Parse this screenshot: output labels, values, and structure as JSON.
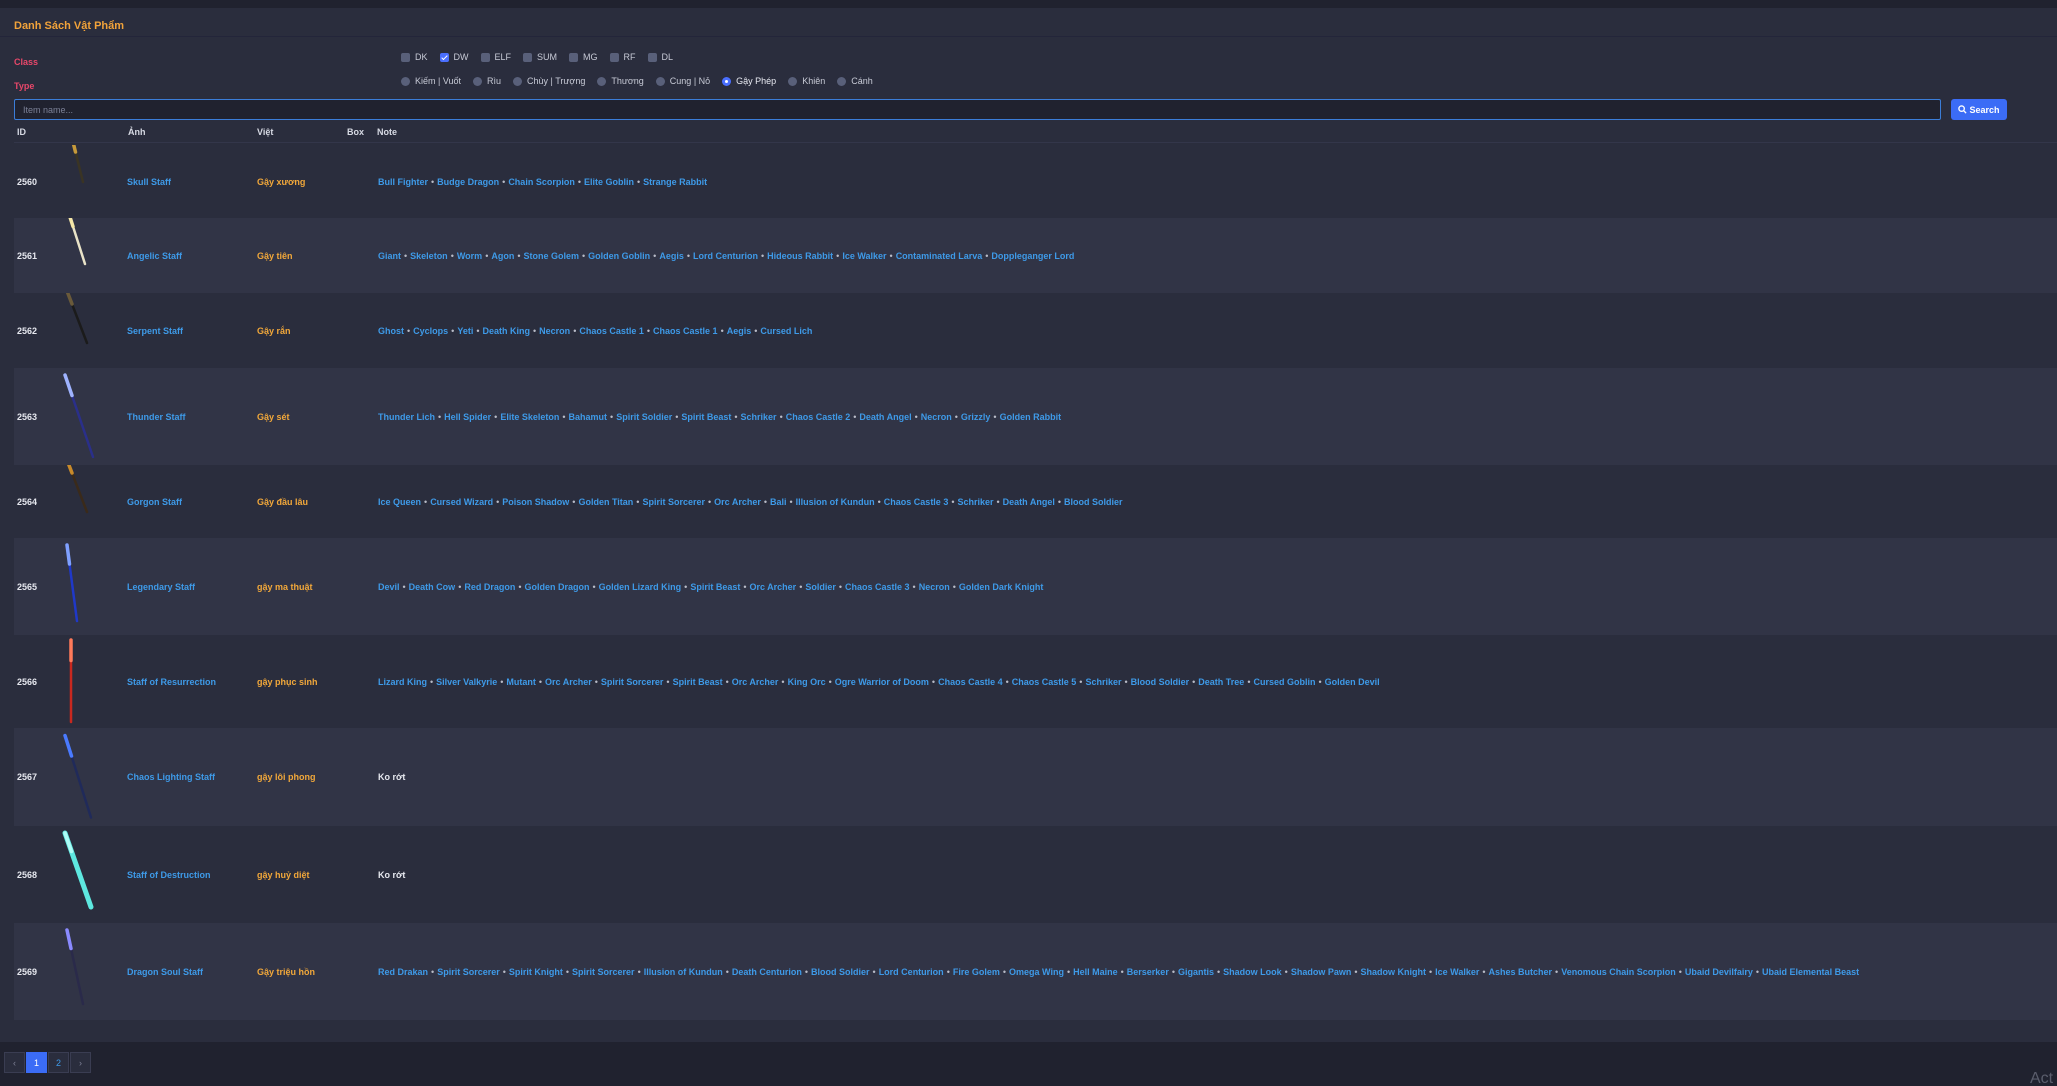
{
  "title": "Danh Sách Vật Phẩm",
  "filters": {
    "class_label": "Class",
    "type_label": "Type",
    "classes": [
      {
        "label": "DK",
        "checked": false
      },
      {
        "label": "DW",
        "checked": true
      },
      {
        "label": "ELF",
        "checked": false
      },
      {
        "label": "SUM",
        "checked": false
      },
      {
        "label": "MG",
        "checked": false
      },
      {
        "label": "RF",
        "checked": false
      },
      {
        "label": "DL",
        "checked": false
      }
    ],
    "types": [
      {
        "label": "Kiếm | Vuốt",
        "selected": false
      },
      {
        "label": "Rìu",
        "selected": false
      },
      {
        "label": "Chùy | Trượng",
        "selected": false
      },
      {
        "label": "Thương",
        "selected": false
      },
      {
        "label": "Cung | Nỏ",
        "selected": false
      },
      {
        "label": "Gậy Phép",
        "selected": true
      },
      {
        "label": "Khiên",
        "selected": false
      },
      {
        "label": "Cánh",
        "selected": false
      }
    ]
  },
  "search": {
    "placeholder": "Item name...",
    "value": "",
    "button_label": "Search"
  },
  "table": {
    "headers": {
      "id": "ID",
      "img": "Ảnh",
      "viet": "Việt",
      "box": "Box",
      "note": "Note"
    },
    "rows": [
      {
        "id": "2560",
        "name": "Skull Staff",
        "viet": "Gậy xương",
        "icon": "skull-staff-icon",
        "note": [
          "Bull Fighter",
          "Budge Dragon",
          "Chain Scorpion",
          "Elite Goblin",
          "Strange Rabbit"
        ]
      },
      {
        "id": "2561",
        "name": "Angelic Staff",
        "viet": "Gậy tiên",
        "icon": "angelic-staff-icon",
        "note": [
          "Giant",
          "Skeleton",
          "Worm",
          "Agon",
          "Stone Golem",
          "Golden Goblin",
          "Aegis",
          "Lord Centurion",
          "Hideous Rabbit",
          "Ice Walker",
          "Contaminated Larva",
          "Doppleganger Lord"
        ]
      },
      {
        "id": "2562",
        "name": "Serpent Staff",
        "viet": "Gậy rắn",
        "icon": "serpent-staff-icon",
        "note": [
          "Ghost",
          "Cyclops",
          "Yeti",
          "Death King",
          "Necron",
          "Chaos Castle 1",
          "Chaos Castle 1",
          "Aegis",
          "Cursed Lich"
        ]
      },
      {
        "id": "2563",
        "name": "Thunder Staff",
        "viet": "Gậy sét",
        "icon": "thunder-staff-icon",
        "note": [
          "Thunder Lich",
          "Hell Spider",
          "Elite Skeleton",
          "Bahamut",
          "Spirit Soldier",
          "Spirit Beast",
          "Schriker",
          "Chaos Castle 2",
          "Death Angel",
          "Necron",
          "Grizzly",
          "Golden Rabbit"
        ]
      },
      {
        "id": "2564",
        "name": "Gorgon Staff",
        "viet": "Gậy đầu lâu",
        "icon": "gorgon-staff-icon",
        "note": [
          "Ice Queen",
          "Cursed Wizard",
          "Poison Shadow",
          "Golden Titan",
          "Spirit Sorcerer",
          "Orc Archer",
          "Bali",
          "Illusion of Kundun",
          "Chaos Castle 3",
          "Schriker",
          "Death Angel",
          "Blood Soldier"
        ]
      },
      {
        "id": "2565",
        "name": "Legendary Staff",
        "viet": "gậy ma thuật",
        "icon": "legendary-staff-icon",
        "note": [
          "Devil",
          "Death Cow",
          "Red Dragon",
          "Golden Dragon",
          "Golden Lizard King",
          "Spirit Beast",
          "Orc Archer",
          "Soldier",
          "Chaos Castle 3",
          "Necron",
          "Golden Dark Knight"
        ]
      },
      {
        "id": "2566",
        "name": "Staff of Resurrection",
        "viet": "gậy phục sinh",
        "icon": "resurrection-staff-icon",
        "note": [
          "Lizard King",
          "Silver Valkyrie",
          "Mutant",
          "Orc Archer",
          "Spirit Sorcerer",
          "Spirit Beast",
          "Orc Archer",
          "King Orc",
          "Ogre Warrior of Doom",
          "Chaos Castle 4",
          "Chaos Castle 5",
          "Schriker",
          "Blood Soldier",
          "Death Tree",
          "Cursed Goblin",
          "Golden Devil"
        ]
      },
      {
        "id": "2567",
        "name": "Chaos Lighting Staff",
        "viet": "gậy lôi phong",
        "icon": "chaos-lighting-staff-icon",
        "note_plain": "Ko rớt"
      },
      {
        "id": "2568",
        "name": "Staff of Destruction",
        "viet": "gậy huỷ diệt",
        "icon": "destruction-staff-icon",
        "note_plain": "Ko rớt"
      },
      {
        "id": "2569",
        "name": "Dragon Soul Staff",
        "viet": "Gậy triệu hồn",
        "icon": "dragon-soul-staff-icon",
        "note": [
          "Red Drakan",
          "Spirit Sorcerer",
          "Spirit Knight",
          "Spirit Sorcerer",
          "Illusion of Kundun",
          "Death Centurion",
          "Blood Soldier",
          "Lord Centurion",
          "Fire Golem",
          "Omega Wing",
          "Hell Maine",
          "Berserker",
          "Gigantis",
          "Shadow Look",
          "Shadow Pawn",
          "Shadow Knight",
          "Ice Walker",
          "Ashes Butcher",
          "Venomous Chain Scorpion",
          "Ubaid Devilfairy",
          "Ubaid Elemental Beast"
        ]
      }
    ]
  },
  "pagination": {
    "prev": "‹",
    "next": "›",
    "pages": [
      "1",
      "2"
    ],
    "current": "1"
  },
  "watermark": "Act",
  "colors": {
    "accent": "#3b6cf6",
    "link": "#3e9ae8",
    "viet": "#f2a83a",
    "label": "#e8476a",
    "title": "#f2a33a"
  }
}
